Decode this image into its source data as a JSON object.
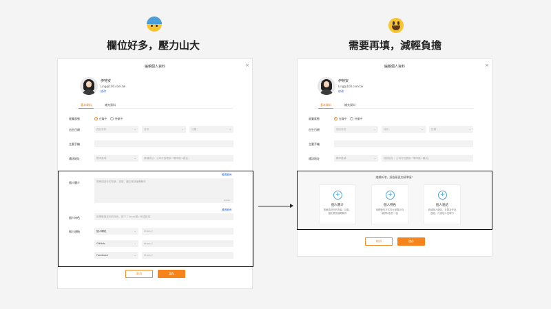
{
  "left_heading": "欄位好多，壓力山大",
  "right_heading": "需要再填，減輕負擔",
  "left_emoji": "anxious-sweat-emoji",
  "right_emoji": "grinning-emoji",
  "colors": {
    "accent": "#f7841b",
    "link": "#2a6bd1",
    "plus": "#4aa7d9"
  },
  "dialog": {
    "title": "編輯個人資料",
    "close": "×",
    "user": {
      "name": "伊特安",
      "email": "Ling@104.com.tw",
      "edit": "修改"
    },
    "tabs": [
      "基本資料",
      "補充資料"
    ],
    "job_status": {
      "label": "就業狀態",
      "options": [
        "在職中",
        "待業中"
      ]
    },
    "birthday": {
      "label": "出生日期",
      "year": "西元年份",
      "month": "月份",
      "day": "日期"
    },
    "phone": {
      "label": "主要手機"
    },
    "address": {
      "label": "通訊地址",
      "region": "縣市區域",
      "detail": "詳細地址：公司可查看到「縣市區+路名」"
    },
    "intro": {
      "label": "個人簡介",
      "example_link": "看看範例",
      "placeholder": "簡單描述你的背景、技能，讓企業快速瞭解你",
      "counter": "0/200"
    },
    "traits": {
      "label": "個人特色",
      "example_link": "看看範例",
      "placeholder": "用標籤描述你的特色，按下「Enter鍵」完成新增"
    },
    "links": {
      "label": "個人連結",
      "rows": [
        {
          "type": "個人網站",
          "url": "https://"
        },
        {
          "type": "GitHub",
          "url": "https://"
        },
        {
          "type": "Facebook",
          "url": "https://"
        }
      ]
    },
    "cancel": "取消",
    "save": "儲存"
  },
  "right_extra": {
    "hint": "繼續新增，讓推薦更加精準喔！",
    "cards": [
      {
        "title": "個人簡介",
        "desc": "簡單描述你的背景、技能，讓企業快速瞭解你"
      },
      {
        "title": "個人特色",
        "desc": "用標籤的方式向大家展示你最具特色的一面"
      },
      {
        "title": "個人連結",
        "desc": "新增個人網站、社群及作品連結，打造個人品牌力"
      }
    ]
  }
}
